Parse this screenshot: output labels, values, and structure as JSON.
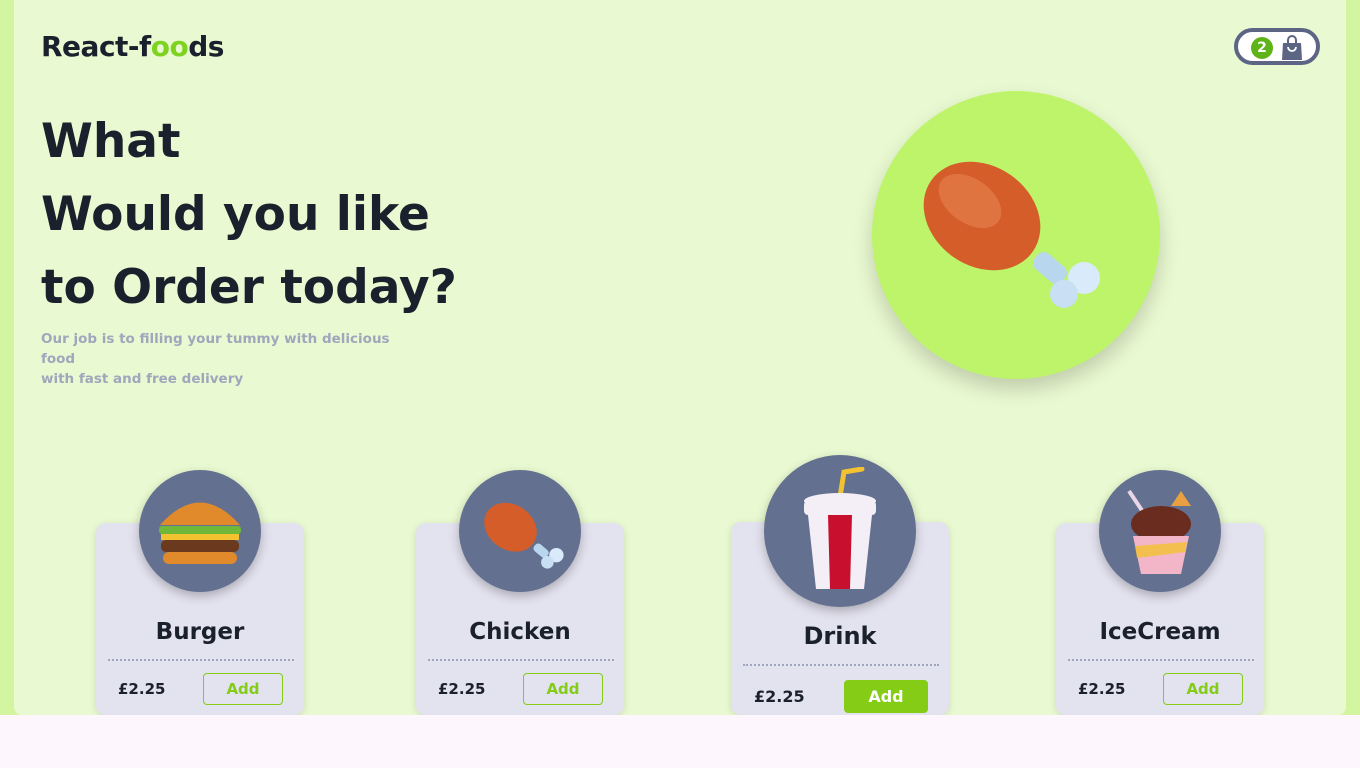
{
  "header": {
    "logo_prefix": "React-f",
    "logo_highlight": "oo",
    "logo_suffix": "ds",
    "cart_count": "2",
    "cart_icon": "shopping-bag-icon"
  },
  "hero": {
    "line1": "What",
    "line2": "Would you like",
    "line3": "to Order today?",
    "subtitle_line1": "Our job is to filling your tummy with delicious food",
    "subtitle_line2": "with fast and free delivery",
    "image": "chicken-leg-icon"
  },
  "products": [
    {
      "name": "Burger",
      "price": "£2.25",
      "button": "Add",
      "icon": "burger-icon",
      "selected": false
    },
    {
      "name": "Chicken",
      "price": "£2.25",
      "button": "Add",
      "icon": "chicken-leg-icon",
      "selected": false
    },
    {
      "name": "Drink",
      "price": "£2.25",
      "button": "Add",
      "icon": "drink-cup-icon",
      "selected": true
    },
    {
      "name": "IceCream",
      "price": "£2.25",
      "button": "Add",
      "icon": "ice-cream-icon",
      "selected": false
    }
  ],
  "colors": {
    "accent": "#84cc16",
    "background": "#e9f9d1",
    "card": "#e3e2ef",
    "circle": "#637090"
  }
}
